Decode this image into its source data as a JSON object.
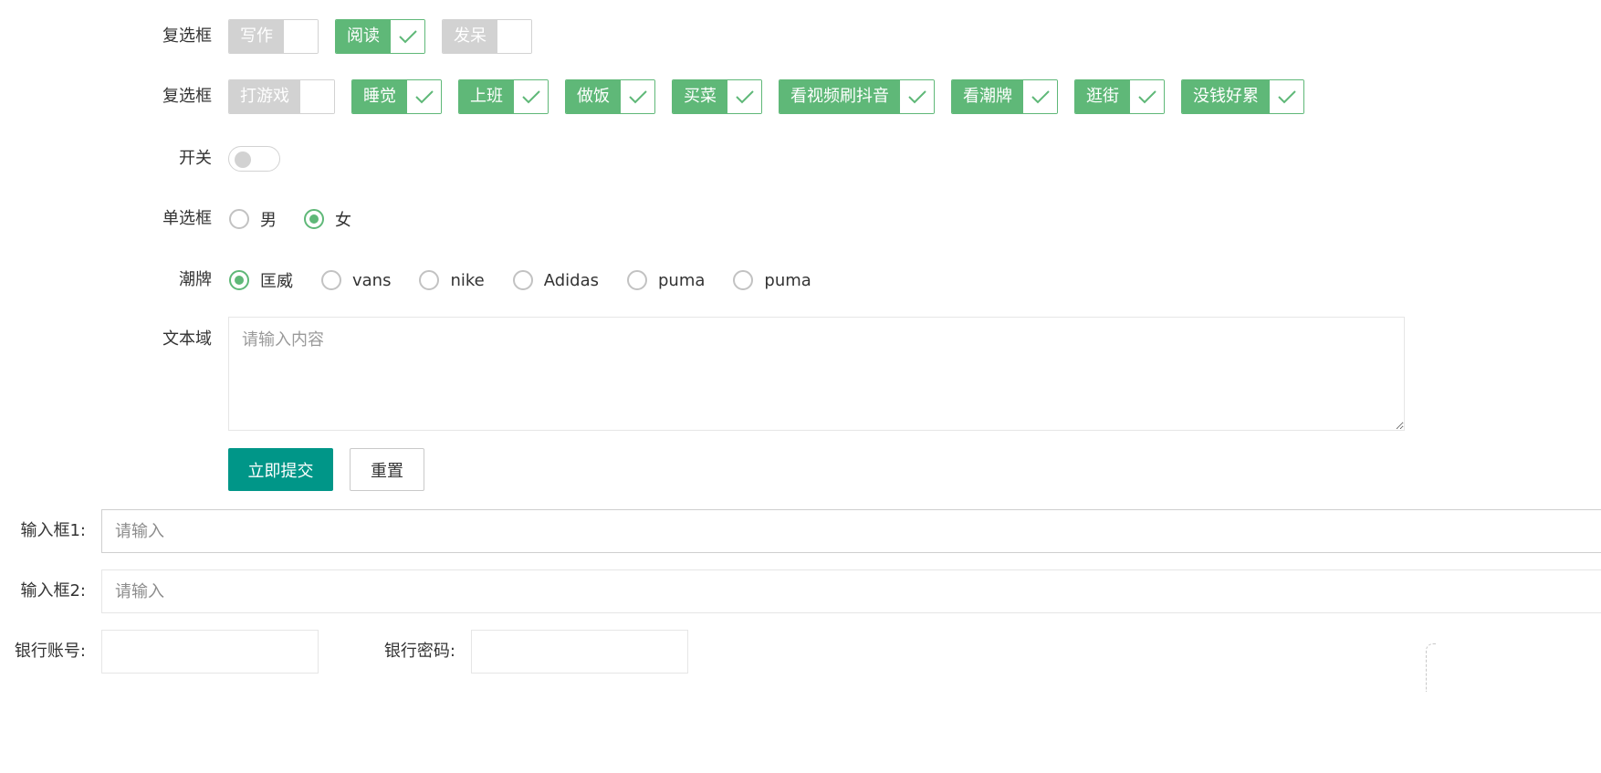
{
  "colors": {
    "accent": "#5fb878",
    "primary_button": "#009688",
    "checkbox_off": "#d2d2d2"
  },
  "checkbox_row1": {
    "label": "复选框",
    "items": [
      {
        "text": "写作",
        "checked": false
      },
      {
        "text": "阅读",
        "checked": true
      },
      {
        "text": "发呆",
        "checked": false
      }
    ]
  },
  "checkbox_row2": {
    "label": "复选框",
    "items": [
      {
        "text": "打游戏",
        "checked": false
      },
      {
        "text": "睡觉",
        "checked": true
      },
      {
        "text": "上班",
        "checked": true
      },
      {
        "text": "做饭",
        "checked": true
      },
      {
        "text": "买菜",
        "checked": true
      },
      {
        "text": "看视频刷抖音",
        "checked": true
      },
      {
        "text": "看潮牌",
        "checked": true
      },
      {
        "text": "逛街",
        "checked": true
      },
      {
        "text": "没钱好累",
        "checked": true
      }
    ]
  },
  "switch_row": {
    "label": "开关",
    "on": false
  },
  "radio_row": {
    "label": "单选框",
    "options": [
      {
        "text": "男",
        "checked": false
      },
      {
        "text": "女",
        "checked": true
      }
    ]
  },
  "brand_row": {
    "label": "潮牌",
    "options": [
      {
        "text": "匡威",
        "checked": true
      },
      {
        "text": "vans",
        "checked": false
      },
      {
        "text": "nike",
        "checked": false
      },
      {
        "text": "Adidas",
        "checked": false
      },
      {
        "text": "puma",
        "checked": false
      },
      {
        "text": "puma",
        "checked": false
      }
    ]
  },
  "textarea_row": {
    "label": "文本域",
    "placeholder": "请输入内容"
  },
  "buttons": {
    "submit": "立即提交",
    "reset": "重置"
  },
  "input1": {
    "label": "输入框1:",
    "placeholder": "请输入"
  },
  "input2": {
    "label": "输入框2:",
    "placeholder": "请输入"
  },
  "bank": {
    "account_label": "银行账号:",
    "password_label": "银行密码:"
  }
}
